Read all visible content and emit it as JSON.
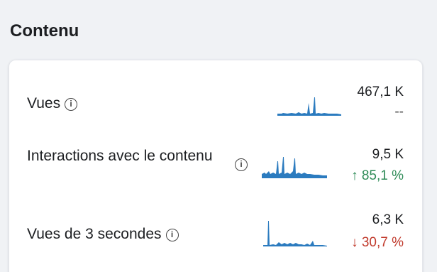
{
  "section": {
    "title": "Contenu"
  },
  "colors": {
    "spark": "#2b7bbf",
    "up": "#2e8b57",
    "down": "#c0392b"
  },
  "metrics": [
    {
      "label": "Vues",
      "info_icon": "info-circle-icon",
      "value": "467,1 K",
      "change": "--"
    },
    {
      "label": "Interactions avec le contenu",
      "info_icon": "info-circle-icon",
      "value": "9,5 K",
      "change": "↑ 85,1 %"
    },
    {
      "label": "Vues de 3 secondes",
      "info_icon": "info-circle-icon",
      "value": "6,3 K",
      "change": "↓ 30,7 %"
    }
  ]
}
